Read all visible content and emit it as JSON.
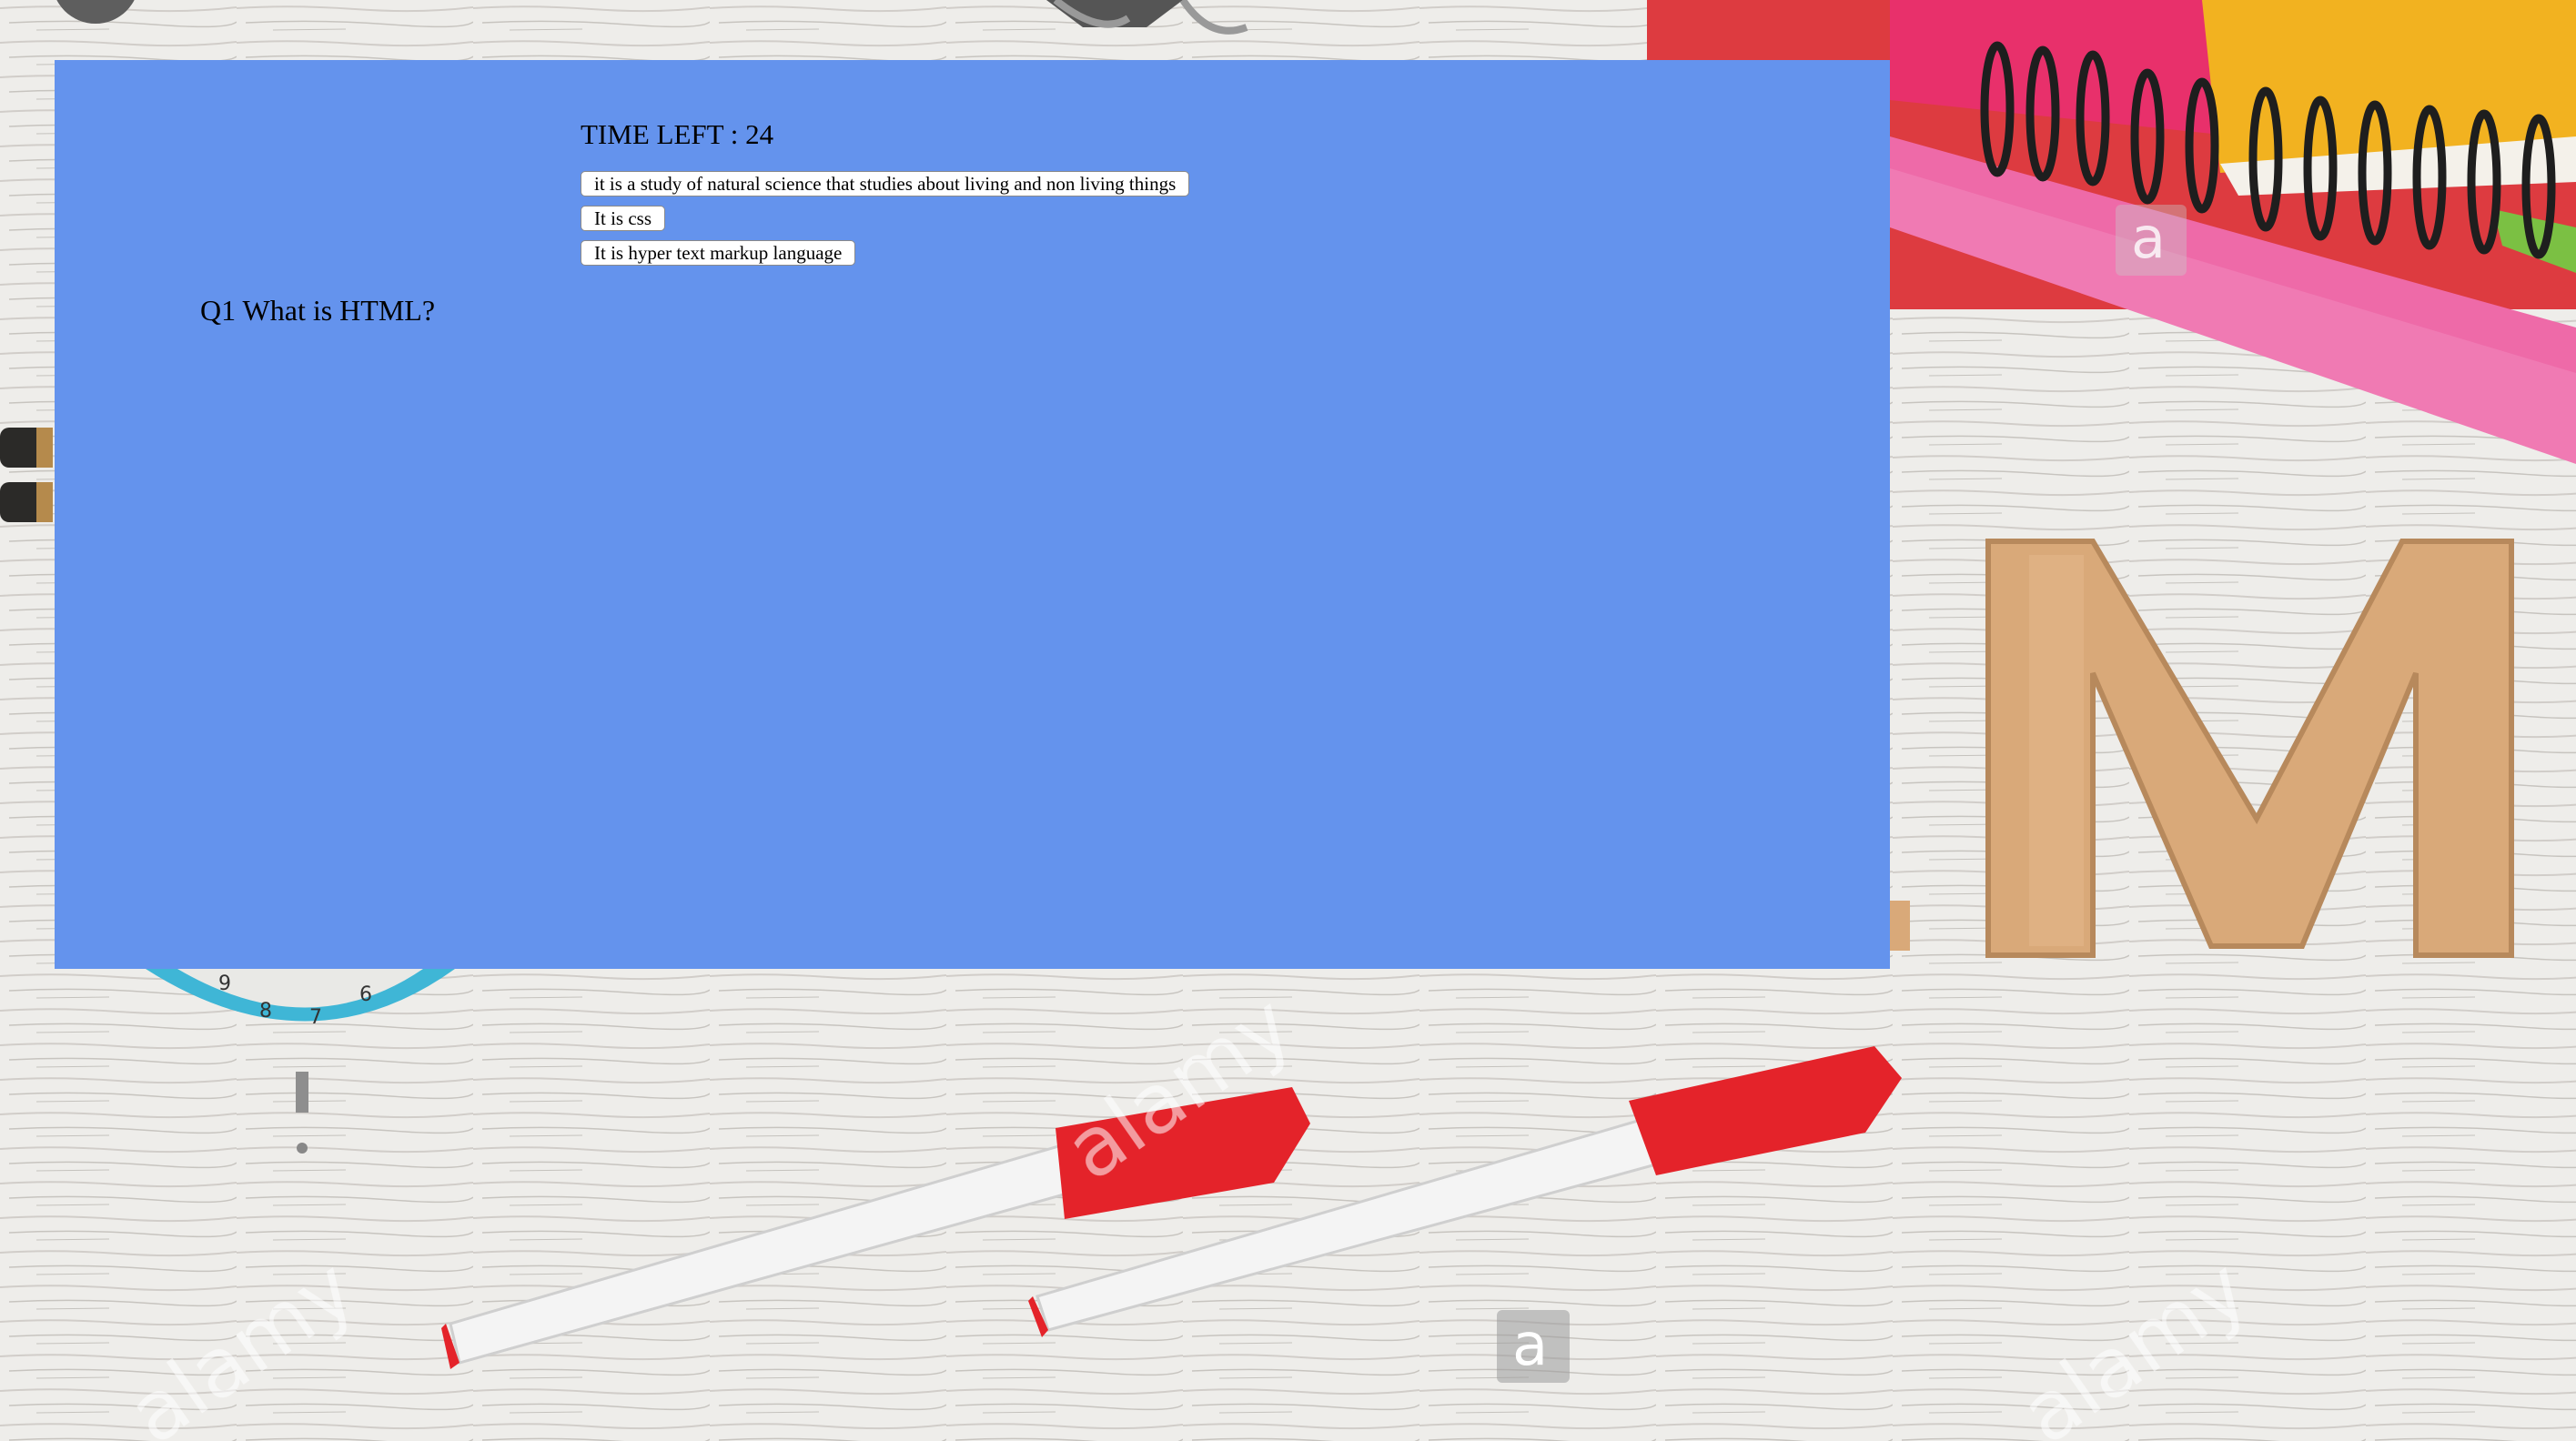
{
  "quiz": {
    "timer_label": "TIME LEFT : 24",
    "question": "Q1 What is HTML?",
    "options": [
      "it is a study of natural science that studies about living and non living things",
      "It is css",
      "It is hyper text markup language"
    ]
  },
  "background": {
    "watermark": "alamy",
    "clock_numbers": [
      "9",
      "8",
      "7",
      "6"
    ]
  },
  "colors": {
    "panel": "#6493ed",
    "desk": "#ecebe8",
    "pen_cap": "#e4232a",
    "wooden_letter": "#d9a979"
  }
}
